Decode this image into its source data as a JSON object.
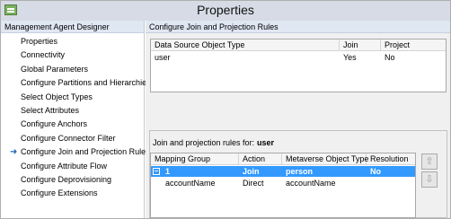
{
  "window": {
    "title": "Properties"
  },
  "icons": {
    "app": "app-icon",
    "current_arrow": "arrow-right-icon",
    "expander": "collapse-minus-icon",
    "move_up": "arrow-up-icon",
    "move_down": "arrow-down-icon"
  },
  "glyphs": {
    "arrow": "➜",
    "minus": "−",
    "up": "⇧",
    "down": "⇩"
  },
  "left_pane": {
    "header": "Management Agent Designer",
    "items": [
      {
        "label": "Properties",
        "current": false
      },
      {
        "label": "Connectivity",
        "current": false
      },
      {
        "label": "Global Parameters",
        "current": false
      },
      {
        "label": "Configure Partitions and Hierarchies",
        "current": false
      },
      {
        "label": "Select Object Types",
        "current": false
      },
      {
        "label": "Select Attributes",
        "current": false
      },
      {
        "label": "Configure Anchors",
        "current": false
      },
      {
        "label": "Configure Connector Filter",
        "current": false
      },
      {
        "label": "Configure Join and Projection Rules",
        "current": true
      },
      {
        "label": "Configure Attribute Flow",
        "current": false
      },
      {
        "label": "Configure Deprovisioning",
        "current": false
      },
      {
        "label": "Configure Extensions",
        "current": false
      }
    ]
  },
  "right_pane": {
    "header": "Configure Join and Projection Rules",
    "object_table": {
      "columns": [
        "Data Source Object Type",
        "Join",
        "Project"
      ],
      "rows": [
        {
          "type": "user",
          "join": "Yes",
          "project": "No"
        }
      ]
    },
    "rules_label": "Join and projection rules for:",
    "rules_object": "user",
    "rules_table": {
      "columns": [
        "Mapping Group",
        "Action",
        "Metaverse Object Type",
        "Resolution"
      ],
      "rows": [
        {
          "group": "1",
          "action": "Join",
          "mv_type": "person",
          "resolution": "No"
        },
        {
          "group": "accountName",
          "action": "Direct",
          "mv_type": "accountName",
          "resolution": ""
        }
      ]
    }
  }
}
